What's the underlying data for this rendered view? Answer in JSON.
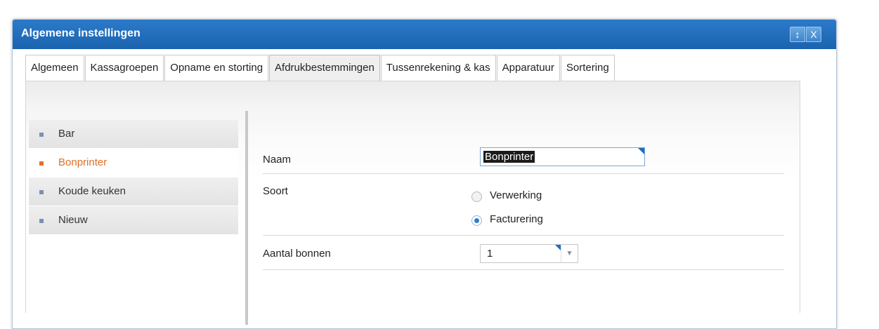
{
  "window": {
    "title": "Algemene instellingen",
    "pin_icon": "pin-icon",
    "close_icon": "close-icon",
    "pin_glyph": "↕",
    "close_glyph": "X"
  },
  "tabs": [
    {
      "label": "Algemeen",
      "active": false
    },
    {
      "label": "Kassagroepen",
      "active": false
    },
    {
      "label": "Opname en storting",
      "active": false
    },
    {
      "label": "Afdrukbestemmingen",
      "active": true
    },
    {
      "label": "Tussenrekening & kas",
      "active": false
    },
    {
      "label": "Apparatuur",
      "active": false
    },
    {
      "label": "Sortering",
      "active": false
    }
  ],
  "sidebar": {
    "items": [
      {
        "label": "Bar",
        "selected": false
      },
      {
        "label": "Bonprinter",
        "selected": true
      },
      {
        "label": "Koude keuken",
        "selected": false
      },
      {
        "label": "Nieuw",
        "selected": false
      }
    ]
  },
  "form": {
    "name_label": "Naam",
    "name_value": "Bonprinter",
    "type_label": "Soort",
    "type_options": [
      {
        "label": "Verwerking",
        "checked": false
      },
      {
        "label": "Facturering",
        "checked": true
      }
    ],
    "count_label": "Aantal bonnen",
    "count_value": "1",
    "count_arrow": "▼"
  },
  "colors": {
    "titlebar": "#1a63ae",
    "accent_orange": "#e0702a",
    "radio_blue": "#2f7fd1"
  }
}
